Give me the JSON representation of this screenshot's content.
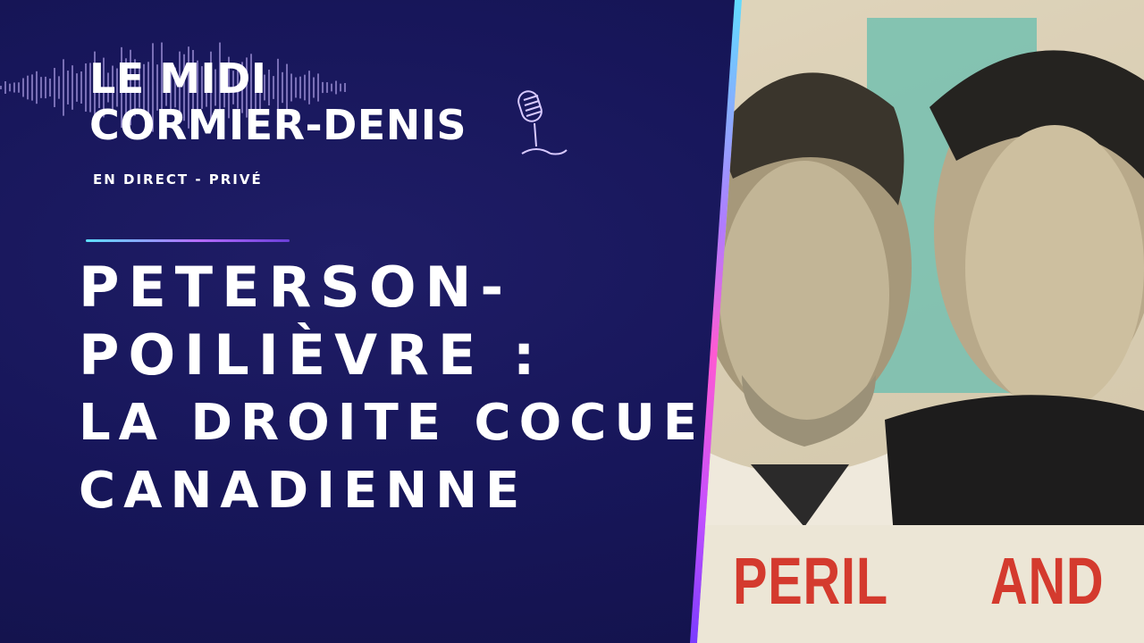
{
  "show": {
    "title_line1": "LE MIDI",
    "title_line2": "CORMIER-DENIS",
    "subtitle": "EN DIRECT - PRIVÉ"
  },
  "headline": {
    "line1": "PETERSON-",
    "line2": "POILIÈVRE :",
    "line3": "LA DROITE COCUE",
    "line4": "CANADIENNE"
  },
  "photo": {
    "word_left": "PERIL",
    "word_right": "AND"
  },
  "colors": {
    "background": "#17165a",
    "text": "#ffffff",
    "accent_cyan": "#5de0ff",
    "accent_pink": "#ff5ad2",
    "accent_purple": "#b66cff",
    "poster_red": "#d43a2e",
    "poster_teal": "#3fb8ae"
  },
  "icons": [
    "waveform-icon",
    "microphone-icon"
  ]
}
